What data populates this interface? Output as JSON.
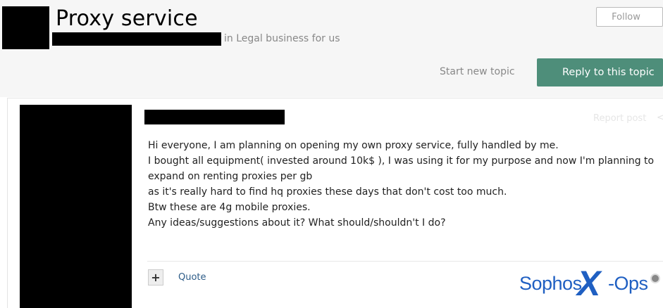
{
  "header": {
    "title": "Proxy service",
    "forum": "in Legal business for us",
    "follow_label": "Follow"
  },
  "actions": {
    "start_topic_label": "Start new topic",
    "reply_label": "Reply to this topic"
  },
  "post": {
    "report_label": "Report post",
    "share_label": "<",
    "lines": [
      "Hi everyone, I am planning on opening my own proxy service, fully handled by me.",
      "I bought all equipment( invested around 10k$ ), I was using it for my purpose and now I'm planning to",
      "expand on renting proxies per gb",
      "as it's really hard to find hq proxies these days that don't cost too much.",
      "Btw these are 4g mobile proxies.",
      "Any ideas/suggestions about it? What should/shouldn't I do?"
    ],
    "plus_label": "+",
    "quote_label": "Quote"
  },
  "logo": {
    "part1": "Sophos",
    "part2": "X",
    "part3": "-Ops"
  },
  "colors": {
    "reply_button": "#4e8e7a",
    "quote_link": "#2d5c88",
    "logo_blue": "#1f5fc2"
  }
}
